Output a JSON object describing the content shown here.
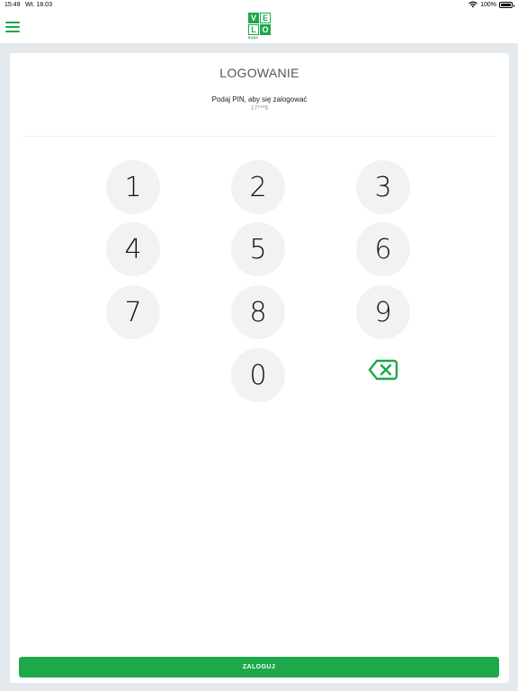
{
  "status_bar": {
    "time": "15:49",
    "date": "Wt. 18.03",
    "battery": "100%"
  },
  "header": {
    "logo_letters": [
      "V",
      "E",
      "L",
      "O"
    ],
    "logo_sub": "BANK"
  },
  "login": {
    "title": "LOGOWANIE",
    "instruction": "Podaj PIN, aby się zalogować",
    "masked_id": "17***6"
  },
  "keypad": {
    "keys": [
      "1",
      "2",
      "3",
      "4",
      "5",
      "6",
      "7",
      "8",
      "9",
      "0"
    ],
    "backspace_icon": "backspace-icon"
  },
  "actions": {
    "login_label": "ZALOGUJ"
  },
  "colors": {
    "accent": "#1da84a",
    "background": "#e4e9ee",
    "key_bg": "#f2f2f2"
  }
}
